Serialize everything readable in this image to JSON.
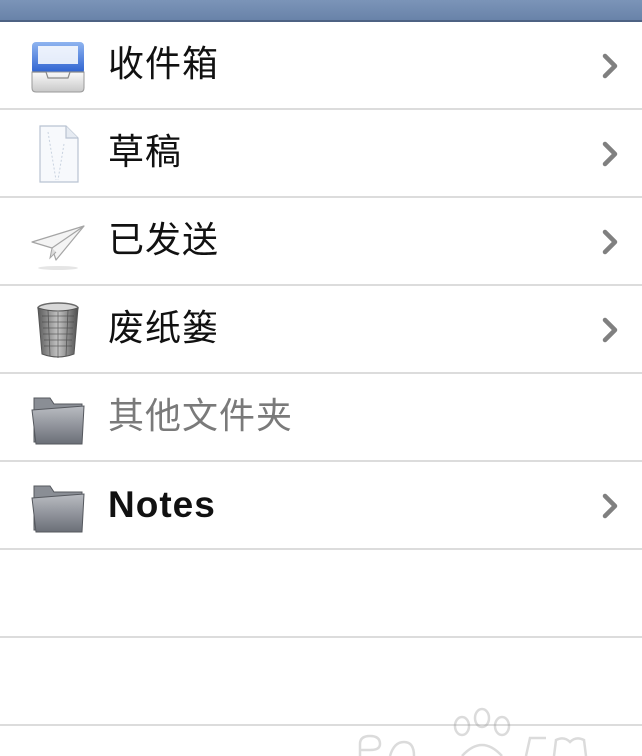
{
  "colors": {
    "header_bar": "#6983a9",
    "separator": "#dcdcdc",
    "chevron": "#808080",
    "text": "#111111",
    "dim_text": "#7a7a7a"
  },
  "mailboxes": [
    {
      "label": "收件箱",
      "icon": "inbox-tray-icon",
      "has_chevron": true
    },
    {
      "label": "草稿",
      "icon": "draft-document-icon",
      "has_chevron": true
    },
    {
      "label": "已发送",
      "icon": "paper-plane-icon",
      "has_chevron": true
    },
    {
      "label": "废纸篓",
      "icon": "trash-can-icon",
      "has_chevron": true
    },
    {
      "label": "其他文件夹",
      "icon": "folder-icon",
      "has_chevron": false
    },
    {
      "label": "Notes",
      "icon": "folder-icon",
      "has_chevron": true
    }
  ],
  "watermark": {
    "icon": "paw-watermark-icon"
  }
}
